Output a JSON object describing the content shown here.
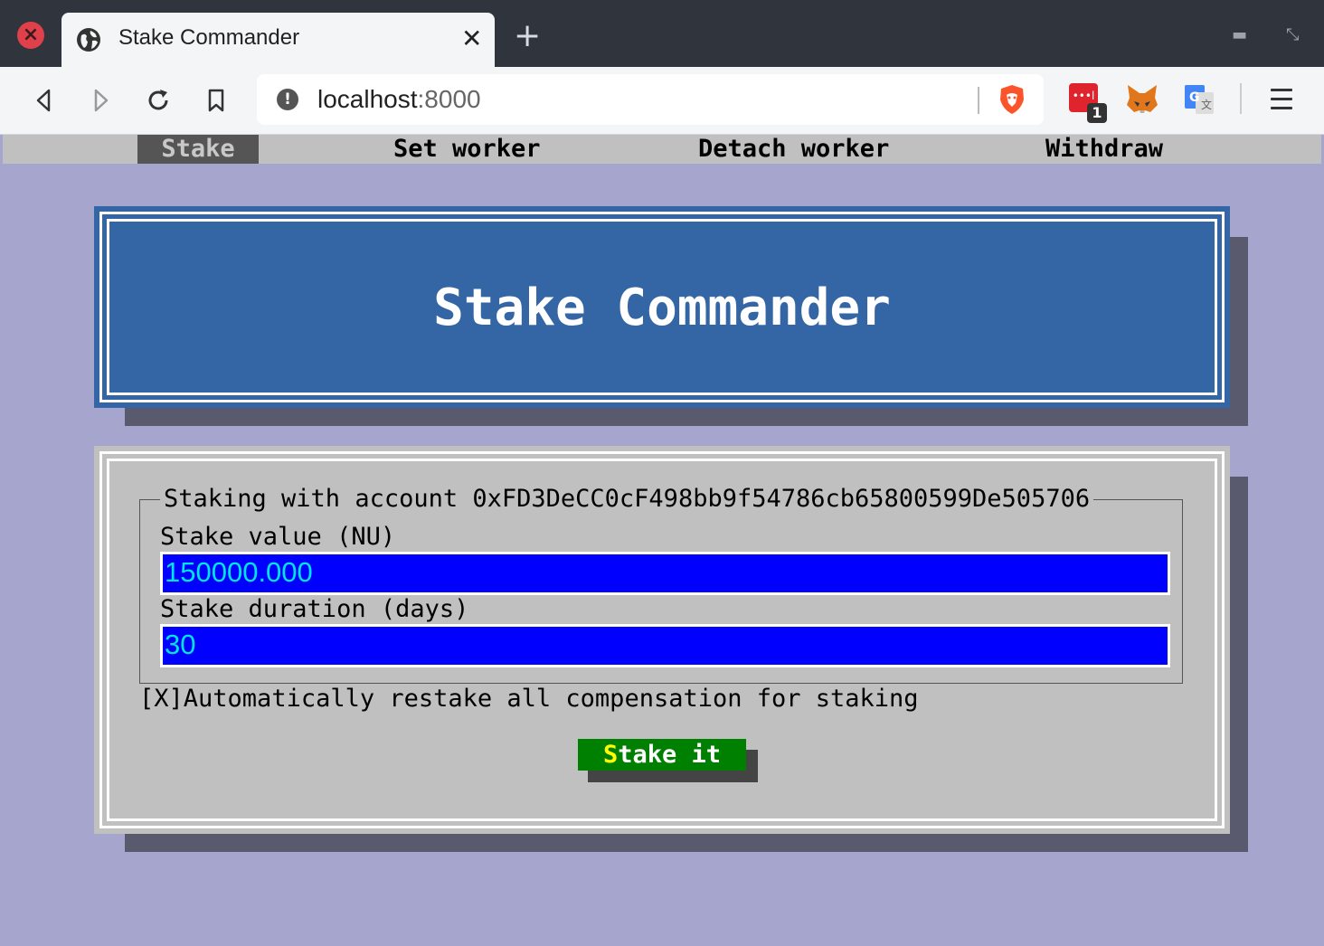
{
  "browser": {
    "tab_title": "Stake Commander",
    "url_host": "localhost",
    "url_port": ":8000",
    "icons": [
      "close-window-icon",
      "globe-icon",
      "tab-close-icon",
      "new-tab-icon",
      "minimize-icon",
      "restore-icon",
      "back-icon",
      "forward-icon",
      "reload-icon",
      "bookmark-icon",
      "site-info-icon",
      "brave-shields-icon",
      "extension-icon",
      "metamask-fox-icon",
      "translate-icon",
      "menu-icon"
    ],
    "extension_badge": "1"
  },
  "menu": {
    "items": [
      {
        "label": "Stake",
        "active": true
      },
      {
        "label": "Set worker",
        "active": false
      },
      {
        "label": "Detach worker",
        "active": false
      },
      {
        "label": "Withdraw",
        "active": false
      }
    ]
  },
  "hero": {
    "title": "Stake Commander"
  },
  "form": {
    "legend": "Staking with account 0xFD3DeCC0cF498bb9f54786cb65800599De505706",
    "stake_value_label": "Stake value (NU)",
    "stake_value": "150000.000",
    "stake_duration_label": "Stake duration (days)",
    "stake_duration": "30",
    "restake_checkbox": "[X]",
    "restake_label": "Automatically restake all compensation for staking",
    "submit_hotkey": "S",
    "submit_rest": "take it"
  },
  "colors": {
    "page_bg": "#a5a5cd",
    "hero_bg": "#3465a4",
    "input_bg": "#0000ff",
    "input_text": "#00e4e4",
    "button_bg": "#008000",
    "button_hotkey": "#ffff00"
  }
}
